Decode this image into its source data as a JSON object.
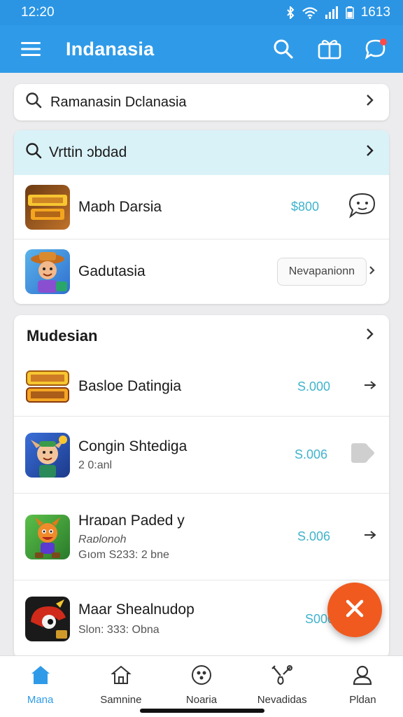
{
  "status": {
    "time": "12:20",
    "right_text": "1613"
  },
  "appbar": {
    "title": "Indanasia",
    "icons": [
      "menu-icon",
      "search-icon",
      "gift-icon",
      "chat-icon"
    ]
  },
  "search_top": {
    "text": "Ramanasin Dclanasia"
  },
  "card_featured": {
    "search_text": "Vrttin ɔbdad",
    "items": [
      {
        "name": "Maɒh Darsia",
        "price": "$800",
        "icon": "game-logo-icon"
      },
      {
        "name": "Gadutasia",
        "action": "Nevapanionn",
        "icon": "game-character-icon"
      }
    ]
  },
  "section": {
    "title": "Mudesian",
    "items": [
      {
        "name": "Basloe Datingia",
        "price": "S.000",
        "icon": "game-logo-icon"
      },
      {
        "name": "Congin Shtediga",
        "sub": "2 0:anl",
        "price": "S.006",
        "icon": "game-character-icon"
      },
      {
        "name": "Hraɒan Paded y",
        "sub": "Raɒlonoh",
        "sub2": "Gıom S233: 2 bne",
        "price": "S.006",
        "icon": "game-character-icon"
      },
      {
        "name": "Maar Shealnudop",
        "sub2": "Slon: 333: Obna",
        "price": "S000",
        "icon": "game-character-icon"
      }
    ]
  },
  "fab": {
    "icon": "close-icon"
  },
  "nav": [
    {
      "label": "Mana",
      "icon": "home-icon",
      "active": true
    },
    {
      "label": "Samnine",
      "icon": "house-outline-icon"
    },
    {
      "label": "Noaria",
      "icon": "soccer-ball-icon"
    },
    {
      "label": "Nevadidas",
      "icon": "tools-icon"
    },
    {
      "label": "Pldan",
      "icon": "profile-icon"
    }
  ],
  "colors": {
    "primary": "#2f9be8",
    "accent": "#f05a1f",
    "price": "#3fb3cc",
    "highlight": "#d9f2f8"
  }
}
